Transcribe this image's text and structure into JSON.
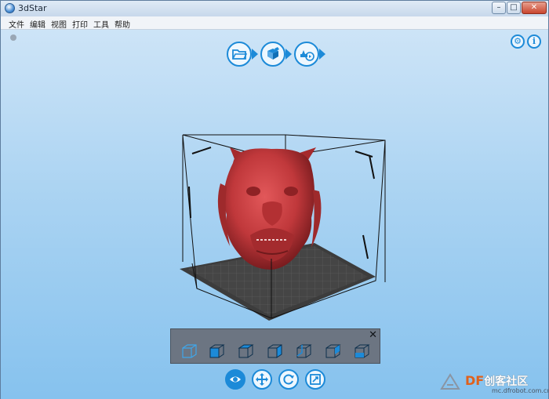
{
  "window": {
    "title": "3dStar",
    "controls": {
      "minimize": "–",
      "maximize": "□",
      "close": "✕"
    }
  },
  "menu": [
    {
      "label": "文件"
    },
    {
      "label": "编辑"
    },
    {
      "label": "视图"
    },
    {
      "label": "打印"
    },
    {
      "label": "工具"
    },
    {
      "label": "帮助"
    }
  ],
  "top_toolbar": {
    "icons": [
      "folder-open-icon",
      "model-repair-icon",
      "print-play-icon"
    ]
  },
  "corner_icons": {
    "settings": "⚙",
    "info": "i"
  },
  "view_panel": {
    "close": "✕",
    "views": [
      "iso-view-icon",
      "front-view-icon",
      "left-view-icon",
      "right-view-icon",
      "back-view-icon",
      "top-view-icon",
      "bottom-view-icon"
    ]
  },
  "bottom_toolbar": {
    "tools": [
      "eye-icon",
      "move-icon",
      "rotate-icon",
      "scale-icon"
    ],
    "active": "eye-icon"
  },
  "watermark": {
    "logo": "DF",
    "text": "创客社区",
    "site": "mc.dfrobot.com.cn"
  },
  "colors": {
    "accent": "#1c8ad8",
    "model": "#c0383b",
    "panel": "#6c7582",
    "watermark": "#e0611b"
  }
}
